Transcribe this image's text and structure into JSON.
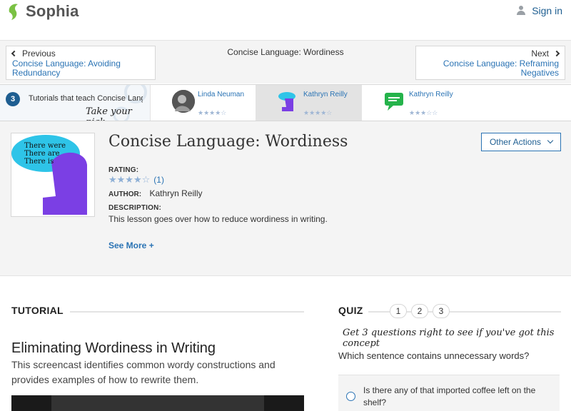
{
  "header": {
    "brand": "Sophia",
    "signin_label": "Sign in"
  },
  "nav": {
    "prev_dir": "Previous",
    "prev_title": "Concise Language: Avoiding Redundancy",
    "current_title": "Concise Language: Wordiness",
    "next_dir": "Next",
    "next_title": "Concise Language: Reframing Negatives"
  },
  "tutorials_strip": {
    "count": "3",
    "label": "Tutorials that teach Concise Language: Wordiness",
    "pick": "Take your pick:",
    "tutors": [
      {
        "name": "Linda Neuman",
        "stars": "★★★★☆"
      },
      {
        "name": "Kathryn Reilly",
        "stars": "★★★★☆"
      },
      {
        "name": "Kathryn Reilly",
        "stars": "★★★☆☆"
      }
    ]
  },
  "lesson": {
    "title": "Concise Language: Wordiness",
    "thumb_text": [
      "There were",
      "There are",
      "There is"
    ],
    "other_actions": "Other Actions",
    "rating_label": "RATING:",
    "rating_stars": "★★★★☆",
    "rating_count": "(1)",
    "author_label": "AUTHOR:",
    "author": "Kathryn Reilly",
    "description_label": "DESCRIPTION:",
    "description": "This lesson goes over how to reduce wordiness in writing.",
    "see_more": "See More +"
  },
  "tutorial": {
    "heading": "TUTORIAL",
    "title": "Eliminating Wordiness in Writing",
    "description": "This screencast identifies common wordy constructions and provides examples of how to rewrite them."
  },
  "quiz": {
    "heading": "QUIZ",
    "numbers": [
      "1",
      "2",
      "3"
    ],
    "hint": "Get 3 questions right to see if you've got this concept",
    "question": "Which sentence contains unnecessary words?",
    "option1": "Is there any of that imported coffee left on the shelf?"
  },
  "colors": {
    "brand_green": "#7ac143",
    "link_blue": "#2a73b4",
    "thumb_purple": "#7b3fe4",
    "thumb_cyan": "#2ec4e8"
  }
}
